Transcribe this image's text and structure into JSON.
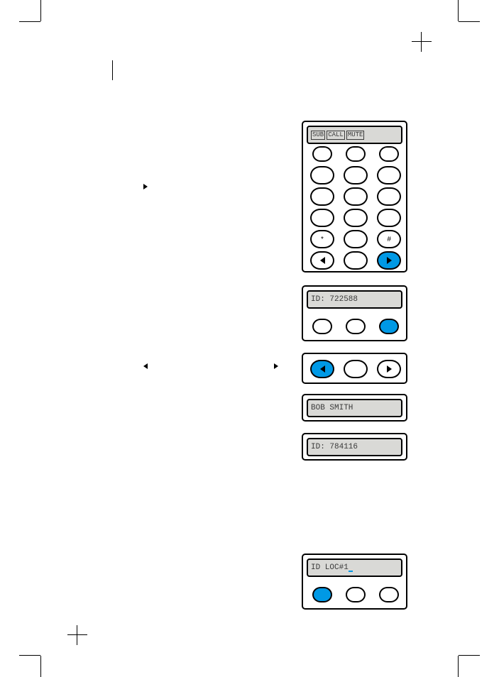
{
  "main_display": {
    "chips": [
      "SUB",
      "CALL",
      "MUTE"
    ]
  },
  "keypad": {
    "star": "*",
    "hash": "#"
  },
  "screens": {
    "id_a": "ID: 722588",
    "name": "BOB SMITH",
    "id_b": "ID: 784116",
    "id_loc": "ID LOC#1"
  }
}
